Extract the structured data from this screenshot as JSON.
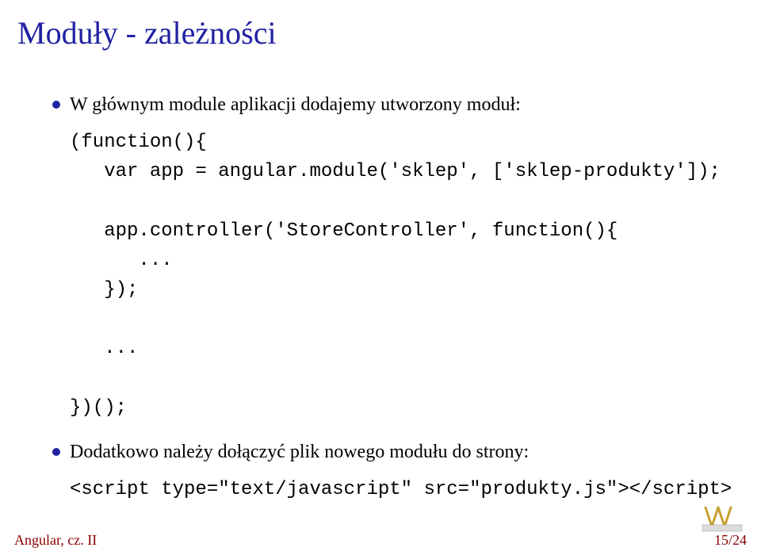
{
  "title": "Moduły - zależności",
  "bullets": {
    "b1": "W głównym module aplikacji dodajemy utworzony moduł:",
    "b2": "Dodatkowo należy dołączyć plik nowego modułu do strony:"
  },
  "code": {
    "block1": "(function(){\n   var app = angular.module('sklep', ['sklep-produkty']);\n\n   app.controller('StoreController', function(){\n      ...\n   });\n\n   ...\n\n})();",
    "block2": "<script type=\"text/javascript\" src=\"produkty.js\"></script>"
  },
  "footer": {
    "left": "Angular, cz. II",
    "right": "15/24"
  }
}
